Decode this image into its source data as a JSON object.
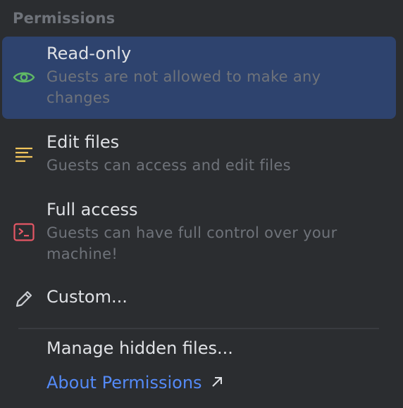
{
  "header": {
    "title": "Permissions"
  },
  "options": [
    {
      "title": "Read-only",
      "description": "Guests are not allowed to make any changes",
      "icon": "eye-icon",
      "icon_color": "#5fb865",
      "selected": true
    },
    {
      "title": "Edit files",
      "description": "Guests can access and edit files",
      "icon": "lines-icon",
      "icon_color": "#f2c55c",
      "selected": false
    },
    {
      "title": "Full access",
      "description": "Guests can have full control over your machine!",
      "icon": "terminal-icon",
      "icon_color": "#e55765",
      "selected": false
    }
  ],
  "custom": {
    "label": "Custom...",
    "icon": "pencil-icon"
  },
  "manage_hidden": {
    "label": "Manage hidden files..."
  },
  "about_link": {
    "label": "About Permissions",
    "icon": "external-arrow-icon",
    "color": "#548af7"
  },
  "colors": {
    "background": "#2b2d30",
    "selection": "#2e436e",
    "text_primary": "#dfe1e5",
    "text_secondary": "#6f737a"
  }
}
